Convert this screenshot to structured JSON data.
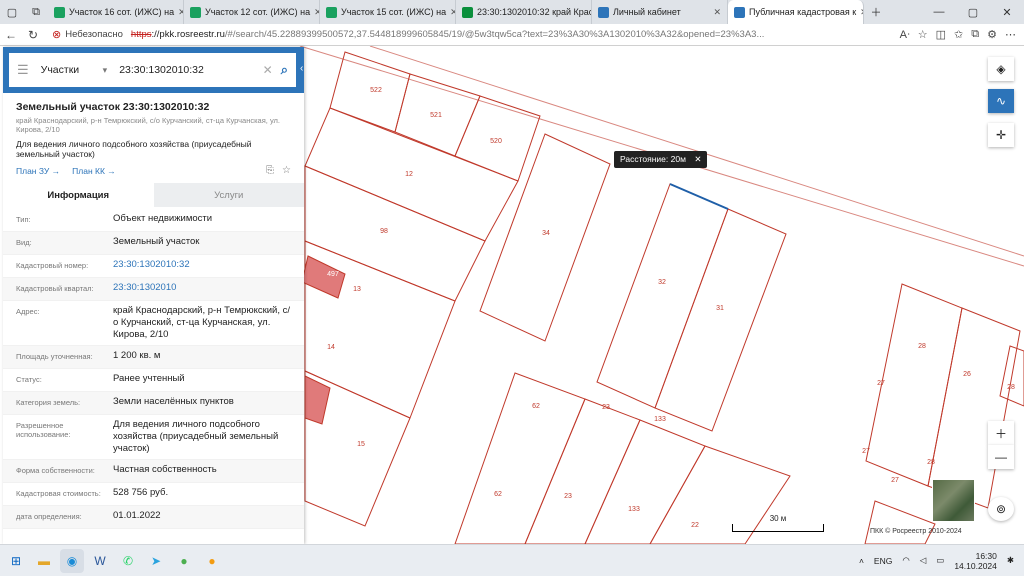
{
  "browser": {
    "tabs": [
      {
        "label": "Участок 16 сот. (ИЖС) на",
        "color": "#1aa15f"
      },
      {
        "label": "Участок 12 сот. (ИЖС) на",
        "color": "#1aa15f"
      },
      {
        "label": "Участок 15 сот. (ИЖС) на",
        "color": "#1aa15f"
      },
      {
        "label": "23:30:1302010:32 край Крас",
        "color": "#0a8f3c"
      },
      {
        "label": "Личный кабинет",
        "color": "#2d74b9"
      },
      {
        "label": "Публичная кадастровая к",
        "color": "#2d74b9"
      }
    ],
    "security_label": "Небезопасно",
    "url_scheme": "https",
    "url_host": "://pkk.rosreestr.ru",
    "url_path": "/#/search/45.22889399500572,37.544818999605845/19/@5w3tqw5ca?text=23%3A30%3A1302010%3A32&opened=23%3A3..."
  },
  "search": {
    "category": "Участки",
    "query": "23:30:1302010:32"
  },
  "parcel": {
    "title": "Земельный участок 23:30:1302010:32",
    "address_short": "край Краснодарский, р-н Темрюкский, с/о Курчанский, ст-ца Курчанская, ул. Кирова, 2/10",
    "purpose": "Для ведения личного подсобного хозяйства (приусадебный земельный участок)",
    "link_plan_zu": "План ЗУ →",
    "link_plan_kk": "План КК →"
  },
  "tabs": {
    "info": "Информация",
    "services": "Услуги"
  },
  "rows": [
    {
      "label": "Тип:",
      "value": "Объект недвижимости",
      "link": false
    },
    {
      "label": "Вид:",
      "value": "Земельный участок",
      "link": false
    },
    {
      "label": "Кадастровый номер:",
      "value": "23:30:1302010:32",
      "link": true
    },
    {
      "label": "Кадастровый квартал:",
      "value": "23:30:1302010",
      "link": true
    },
    {
      "label": "Адрес:",
      "value": "край Краснодарский, р-н Темрюкский, с/о Курчанский, ст-ца Курчанская, ул. Кирова, 2/10",
      "link": false
    },
    {
      "label": "Площадь уточненная:",
      "value": "1 200 кв. м",
      "link": false
    },
    {
      "label": "Статус:",
      "value": "Ранее учтенный",
      "link": false
    },
    {
      "label": "Категория земель:",
      "value": "Земли населённых пунктов",
      "link": false
    },
    {
      "label": "Разрешенное использование:",
      "value": "Для ведения личного подсобного хозяйства (приусадебный земельный участок)",
      "link": false
    },
    {
      "label": "Форма собственности:",
      "value": "Частная собственность",
      "link": false
    },
    {
      "label": "Кадастровая стоимость:",
      "value": "528 756 руб.",
      "link": false
    },
    {
      "label": "дата определения:",
      "value": "01.01.2022",
      "link": false
    }
  ],
  "map": {
    "tooltip": "Расстояние: 20м",
    "scale_label": "30 м",
    "copyright": "ПКК © Росреестр 2010-2024",
    "parcel_labels": [
      "522",
      "521",
      "520",
      "12",
      "98",
      "34",
      "497",
      "13",
      "14",
      "15",
      "32",
      "31",
      "62",
      "23",
      "133",
      "62",
      "23",
      "133",
      "22",
      "28",
      "27",
      "26",
      "28",
      "27",
      "28",
      "27"
    ]
  },
  "taskbar": {
    "lang": "ENG",
    "time": "16:30",
    "date": "14.10.2024"
  },
  "colors": {
    "accent": "#2d74b9",
    "parcel_line": "#c0392b"
  }
}
